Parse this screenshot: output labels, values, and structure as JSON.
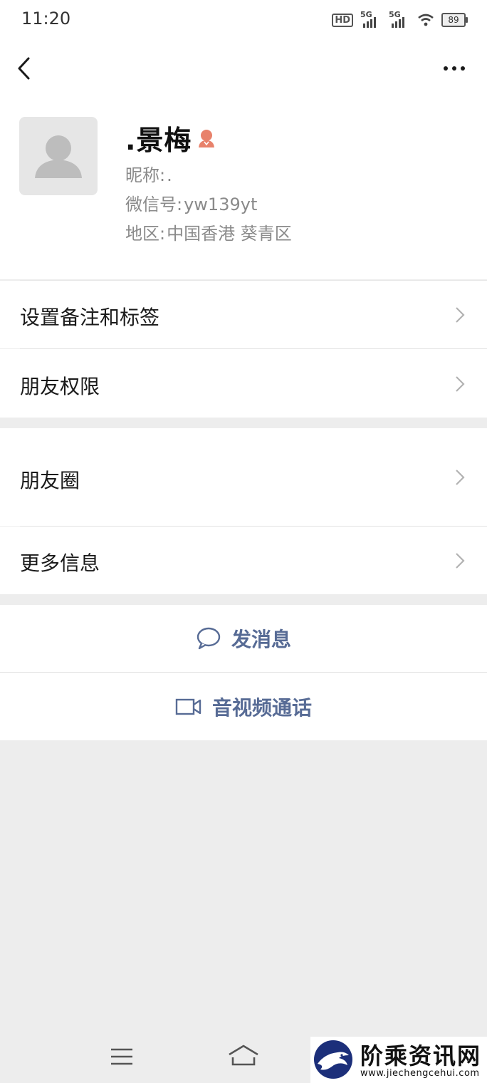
{
  "status_bar": {
    "time": "11:20",
    "hd_label": "HD",
    "network_1": "5G",
    "network_2": "5G",
    "battery": "89"
  },
  "header": {
    "back_icon": "chevron-left-icon",
    "more_icon": "more-dots-icon"
  },
  "profile": {
    "name": ".景梅",
    "gender_icon": "female-icon",
    "nickname_label": "昵称:",
    "nickname_value": ".",
    "wechat_id_label": "微信号:",
    "wechat_id_value": "yw139yt",
    "region_label": "地区:",
    "region_value": "中国香港  葵青区"
  },
  "menu": {
    "remarks_tags": "设置备注和标签",
    "friend_permissions": "朋友权限",
    "moments": "朋友圈",
    "more_info": "更多信息"
  },
  "actions": {
    "send_message": "发消息",
    "video_call": "音视频通话"
  },
  "watermark": {
    "title": "阶乘资讯网",
    "url": "www.jiechengcehui.com"
  },
  "colors": {
    "link_blue": "#576b95",
    "background_gray": "#ededed",
    "female_icon": "#e8826b"
  }
}
